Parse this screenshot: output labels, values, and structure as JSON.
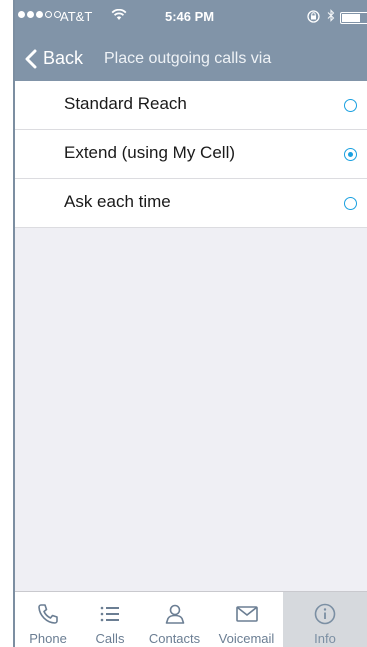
{
  "status_bar": {
    "carrier": "AT&T",
    "time": "5:46 PM",
    "signal_bars_filled": 3,
    "signal_bars_total": 5
  },
  "nav": {
    "back_label": "Back",
    "title": "Place outgoing calls via"
  },
  "options": [
    {
      "label": "Standard Reach",
      "selected": false
    },
    {
      "label": "Extend (using My Cell)",
      "selected": true
    },
    {
      "label": "Ask each time",
      "selected": false
    }
  ],
  "tabs": [
    {
      "label": "Phone",
      "icon": "phone-icon",
      "active": false
    },
    {
      "label": "Calls",
      "icon": "list-icon",
      "active": false
    },
    {
      "label": "Contacts",
      "icon": "contact-icon",
      "active": false
    },
    {
      "label": "Voicemail",
      "icon": "envelope-icon",
      "active": false
    },
    {
      "label": "Info",
      "icon": "info-icon",
      "active": true
    }
  ],
  "colors": {
    "header": "#8194a8",
    "accent": "#1aa0e0",
    "background": "#efeff4",
    "tab_label": "#6b7e93"
  }
}
